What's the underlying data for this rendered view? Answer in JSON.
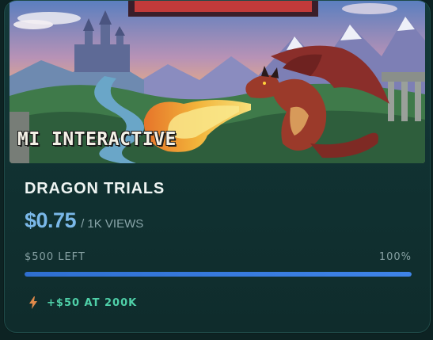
{
  "card": {
    "studio": "MI INTERACTIVE",
    "title": "DRAGON TRIALS",
    "price": "$0.75",
    "per_views": "/ 1K VIEWS",
    "budget_left": "$500 LEFT",
    "budget_percent_label": "100%",
    "budget_fill": 1.0,
    "bonus": "+$50 AT 200K",
    "bonus_icon": "lightning-bolt-icon"
  },
  "colors": {
    "price": "#7ab8e8",
    "bonus": "#4fd0a8",
    "progress": "#3f84e8",
    "bolt": "#e08a4a"
  }
}
